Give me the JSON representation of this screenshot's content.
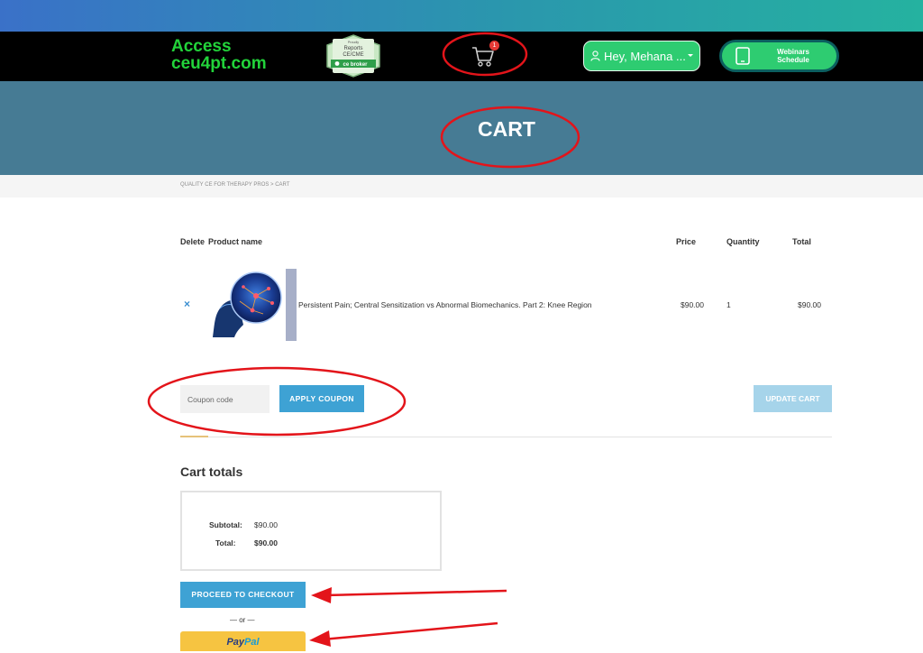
{
  "header": {
    "brand_line1": "Access",
    "brand_line2": "ceu4pt.com",
    "cebroker_small": "Proudly",
    "cebroker_reports": "Reports",
    "cebroker_cecme": "CE/CME",
    "cebroker_name": "ce broker",
    "cart_count": "1",
    "user_label": "Hey, Mehana ...",
    "webinar_label_line1": "Webinars",
    "webinar_label_line2": "Schedule"
  },
  "banner": {
    "title": "CART"
  },
  "breadcrumb": "QUALITY CE FOR THERAPY PROS > CART",
  "table": {
    "headers": {
      "delete": "Delete",
      "product": "Product name",
      "price": "Price",
      "quantity": "Quantity",
      "total": "Total"
    },
    "rows": [
      {
        "remove": "×",
        "name": "Persistent Pain; Central Sensitization vs Abnormal Biomechanics. Part 2: Knee Region",
        "price": "$90.00",
        "quantity": "1",
        "total": "$90.00"
      }
    ]
  },
  "coupon": {
    "placeholder": "Coupon code",
    "apply_label": "APPLY COUPON",
    "update_label": "UPDATE CART"
  },
  "totals": {
    "title": "Cart totals",
    "subtotal_label": "Subtotal:",
    "subtotal_value": "$90.00",
    "total_label": "Total:",
    "total_value": "$90.00"
  },
  "checkout": {
    "proceed_label": "PROCEED TO CHECKOUT",
    "or_label": "— or —",
    "paypal_pay": "Pay",
    "paypal_pal": "Pal"
  },
  "colors": {
    "annotation": "#e3141a",
    "accent": "#3ea2d4",
    "brand_green": "#22d33a",
    "banner": "#467b94"
  }
}
